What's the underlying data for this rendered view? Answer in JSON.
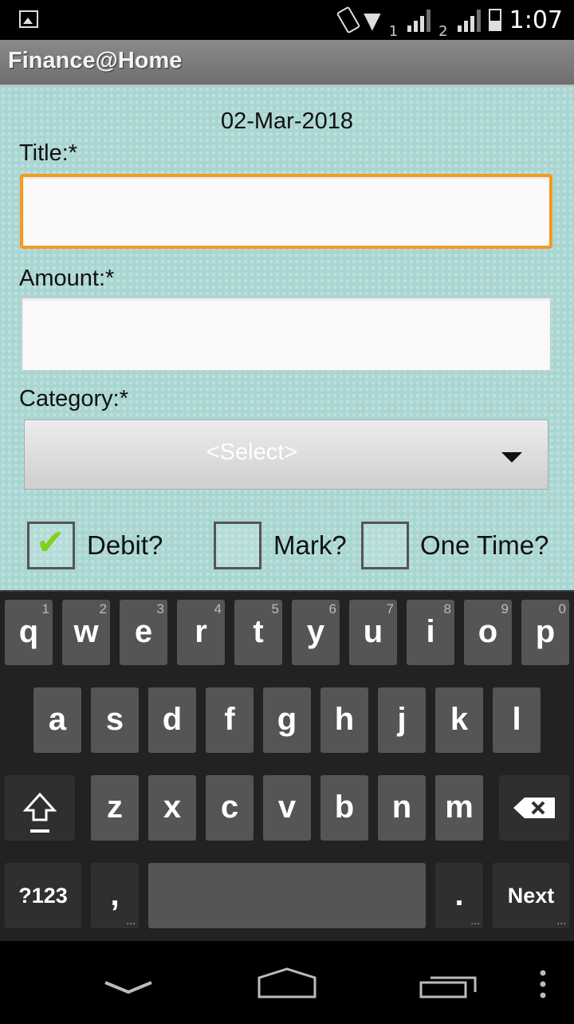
{
  "status_bar": {
    "time": "1:07",
    "sim1": "1",
    "sim2": "2"
  },
  "app": {
    "title": "Finance@Home"
  },
  "form": {
    "date": "02-Mar-2018",
    "title_label": "Title:*",
    "title_value": "",
    "amount_label": "Amount:*",
    "amount_value": "",
    "category_label": "Category:*",
    "category_selected": "<Select>",
    "debit_label": "Debit?",
    "debit_checked": true,
    "mark_label": "Mark?",
    "mark_checked": false,
    "onetime_label": "One Time?",
    "onetime_checked": false
  },
  "keyboard": {
    "row1": [
      {
        "ch": "q",
        "num": "1"
      },
      {
        "ch": "w",
        "num": "2"
      },
      {
        "ch": "e",
        "num": "3"
      },
      {
        "ch": "r",
        "num": "4"
      },
      {
        "ch": "t",
        "num": "5"
      },
      {
        "ch": "y",
        "num": "6"
      },
      {
        "ch": "u",
        "num": "7"
      },
      {
        "ch": "i",
        "num": "8"
      },
      {
        "ch": "o",
        "num": "9"
      },
      {
        "ch": "p",
        "num": "0"
      }
    ],
    "row2": [
      "a",
      "s",
      "d",
      "f",
      "g",
      "h",
      "j",
      "k",
      "l"
    ],
    "row3": [
      "z",
      "x",
      "c",
      "v",
      "b",
      "n",
      "m"
    ],
    "symbols": "?123",
    "comma": ",",
    "period": ".",
    "next": "Next"
  },
  "colors": {
    "accent_focus": "#f39a1f",
    "content_bg": "#a9d6d2",
    "check": "#7fd11b"
  }
}
